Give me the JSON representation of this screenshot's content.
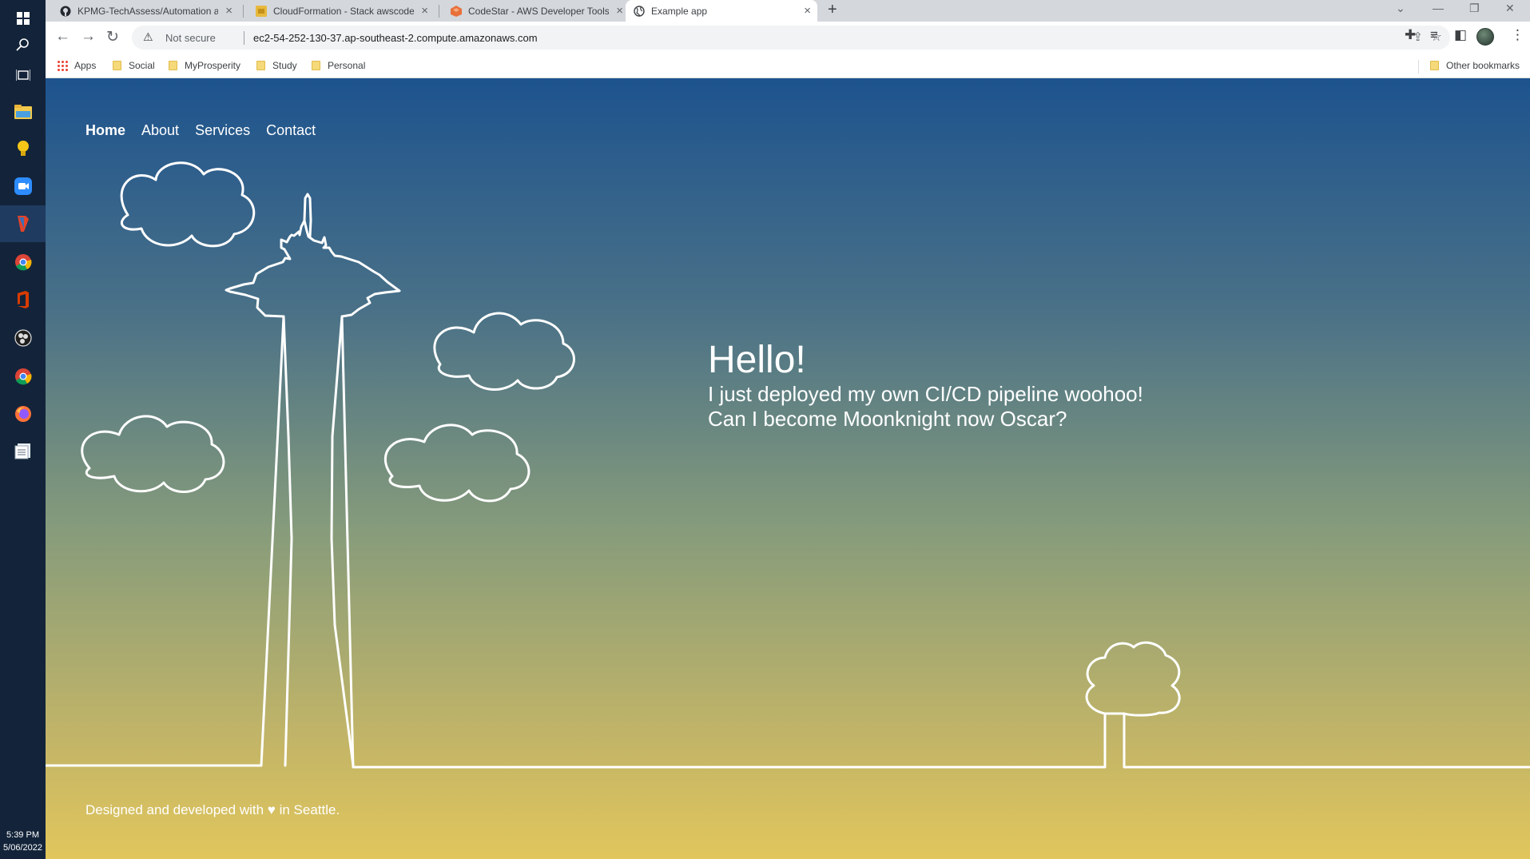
{
  "taskbar": {
    "icons": [
      "windows-start-icon",
      "search-icon",
      "task-view-icon",
      "file-explorer-icon",
      "lightbulb-icon",
      "zoom-icon",
      "git-icon",
      "chrome-icon",
      "office-icon",
      "obs-icon",
      "chrome-icon",
      "firefox-icon",
      "document-stack-icon"
    ],
    "time": "5:39 PM",
    "date": "5/06/2022"
  },
  "browser": {
    "tabs": [
      {
        "title": "KPMG-TechAssess/Automation a",
        "icon": "github-icon",
        "active": false
      },
      {
        "title": "CloudFormation - Stack awscode",
        "icon": "cloudformation-icon",
        "active": false
      },
      {
        "title": "CodeStar - AWS Developer Tools",
        "icon": "codestar-icon",
        "active": false
      },
      {
        "title": "Example app",
        "icon": "globe-icon",
        "active": true
      }
    ],
    "address": {
      "security_label": "Not secure",
      "url": "ec2-54-252-130-37.ap-southeast-2.compute.amazonaws.com"
    },
    "bookmarks": {
      "apps_label": "Apps",
      "items": [
        "Social",
        "MyProsperity",
        "Study",
        "Personal"
      ],
      "other_label": "Other bookmarks"
    }
  },
  "site": {
    "nav": [
      "Home",
      "About",
      "Services",
      "Contact"
    ],
    "hero": {
      "title": "Hello!",
      "line1": "I just deployed my own CI/CD pipeline woohoo!",
      "line2": "Can I become Moonknight now Oscar?"
    },
    "footer": "Designed and developed with ♥ in Seattle."
  },
  "colors": {
    "gradient_top": "#1d538e",
    "gradient_bottom": "#e1c65c",
    "line_art": "#ffffff",
    "taskbar": "#13243a"
  }
}
